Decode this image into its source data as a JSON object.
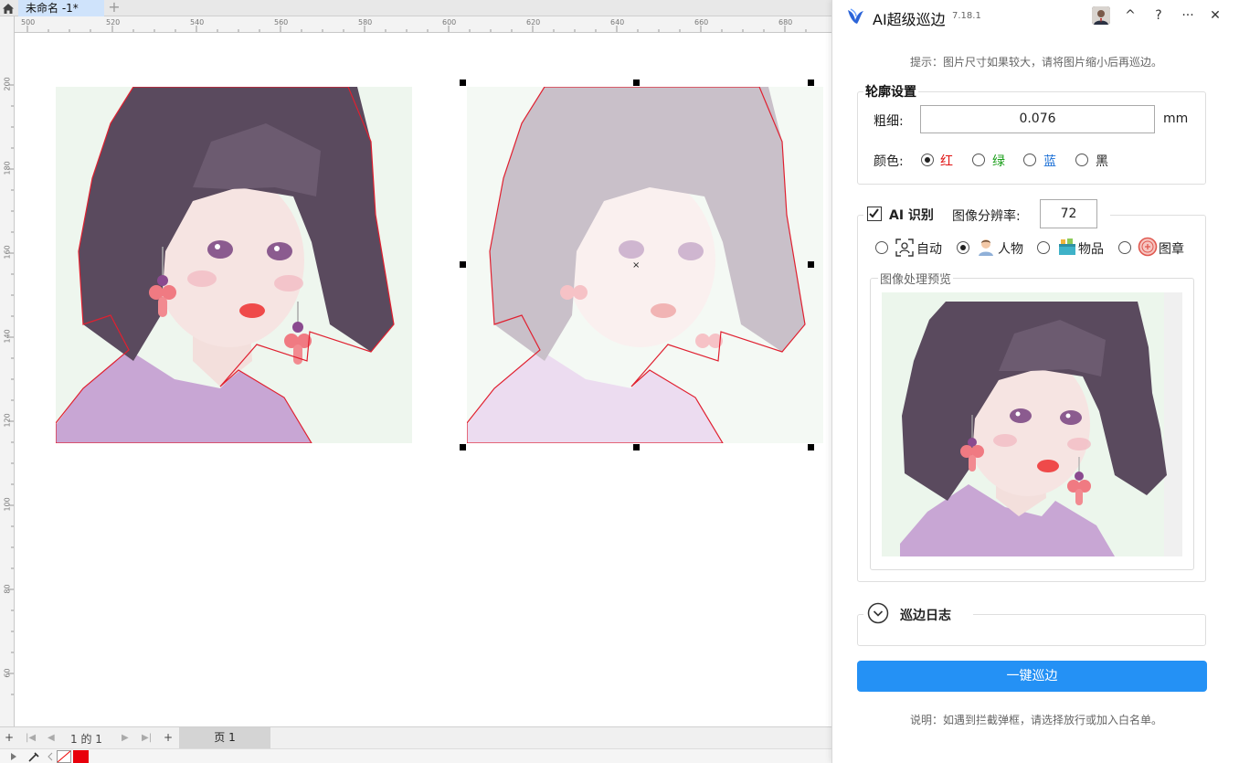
{
  "tabs": {
    "doc_tab_label": "未命名 -1*",
    "new_tab_label": "+"
  },
  "ruler": {
    "top_labels": [
      "500",
      "520",
      "540",
      "560",
      "580",
      "600",
      "620",
      "640",
      "660",
      "680"
    ],
    "left_labels": [
      "200",
      "180",
      "160",
      "140",
      "120",
      "100",
      "80",
      "60"
    ]
  },
  "pagebar": {
    "add_page": "+",
    "first": "|◀",
    "prev": "◀",
    "page_indicator": "1 的 1",
    "next": "▶",
    "last": "▶|",
    "add_page_after": "+",
    "page_tab_label": "页 1"
  },
  "colors": {
    "accent": "#2491f5",
    "fill_swatch": "#e8000b",
    "outline": "#e02030"
  },
  "panel": {
    "title": "AI超级巡边",
    "version": "7.18.1",
    "collapse_glyph": "^",
    "help_glyph": "?",
    "more_glyph": "···",
    "close_glyph": "✕",
    "hint": "提示：图片尺寸如果较大，请将图片缩小后再巡边。",
    "outline_settings": {
      "legend": "轮廓设置",
      "thickness_label": "粗细:",
      "thickness_value": "0.076",
      "unit": "mm",
      "color_label": "颜色:",
      "colors": [
        {
          "label": "红",
          "color": "#e01010",
          "selected": true
        },
        {
          "label": "绿",
          "color": "#1a9e1a",
          "selected": false
        },
        {
          "label": "蓝",
          "color": "#1a6fd6",
          "selected": false
        },
        {
          "label": "黑",
          "color": "#222222",
          "selected": false
        }
      ]
    },
    "ai": {
      "checkbox_label": "AI 识别",
      "checked": true,
      "resolution_label": "图像分辨率:",
      "resolution_value": "72",
      "modes": [
        {
          "label": "自动",
          "icon": "auto-scan-icon",
          "selected": false
        },
        {
          "label": "人物",
          "icon": "person-icon",
          "selected": true
        },
        {
          "label": "物品",
          "icon": "object-box-icon",
          "selected": false
        },
        {
          "label": "图章",
          "icon": "stamp-icon",
          "selected": false
        }
      ],
      "preview_legend": "图像处理预览"
    },
    "log": {
      "title": "巡边日志",
      "expand_glyph": "⌄"
    },
    "run_button": "一键巡边",
    "note": "说明：如遇到拦截弹框，请选择放行或加入白名单。"
  }
}
